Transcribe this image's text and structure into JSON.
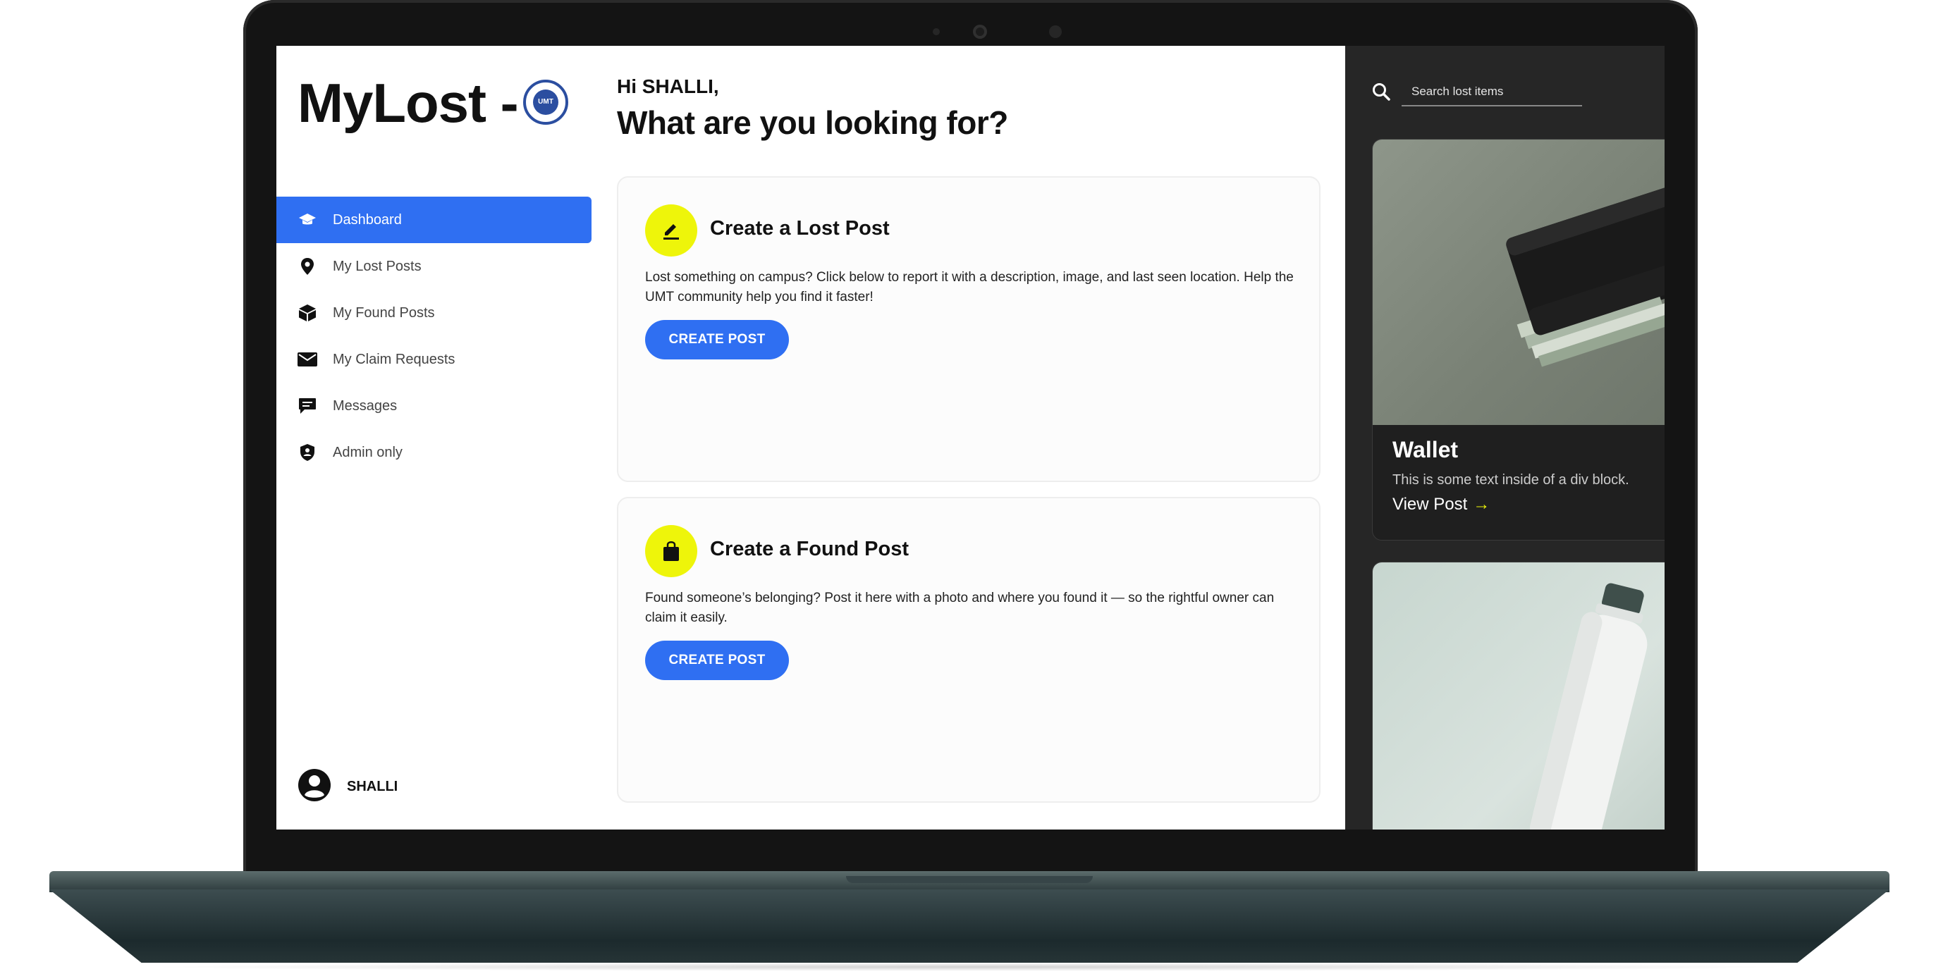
{
  "app": {
    "logo_text": "MyLost -",
    "seal_text": "UMT"
  },
  "sidebar": {
    "items": [
      {
        "label": "Dashboard",
        "icon": "graduation-cap-icon",
        "active": true
      },
      {
        "label": "My Lost Posts",
        "icon": "map-pin-icon",
        "active": false
      },
      {
        "label": "My Found Posts",
        "icon": "box-icon",
        "active": false
      },
      {
        "label": "My Claim Requests",
        "icon": "envelope-icon",
        "active": false
      },
      {
        "label": "Messages",
        "icon": "chat-icon",
        "active": false
      },
      {
        "label": "Admin only",
        "icon": "shield-icon",
        "active": false
      }
    ],
    "user_name": "SHALLI"
  },
  "main": {
    "greeting": "Hi SHALLI,",
    "headline": "What are you looking for?",
    "cards": [
      {
        "title": "Create a Lost Post",
        "icon": "pen-icon",
        "description": "Lost something on campus? Click below to report it with a description, image, and last seen location. Help the UMT community help you find it faster!",
        "button": "CREATE POST"
      },
      {
        "title": "Create a Found Post",
        "icon": "shopping-bag-icon",
        "description": "Found someone’s belonging? Post it here with a photo and where you found it — so the rightful owner can claim it easily.",
        "button": "CREATE POST"
      }
    ]
  },
  "right_panel": {
    "search_placeholder": "Search lost items",
    "posts": [
      {
        "name": "Wallet",
        "description": "This is some text inside of a div block.",
        "link": "View Post"
      }
    ]
  },
  "colors": {
    "accent_blue": "#2f6ff2",
    "accent_yellow": "#eef50a",
    "panel_dark": "#262626"
  }
}
